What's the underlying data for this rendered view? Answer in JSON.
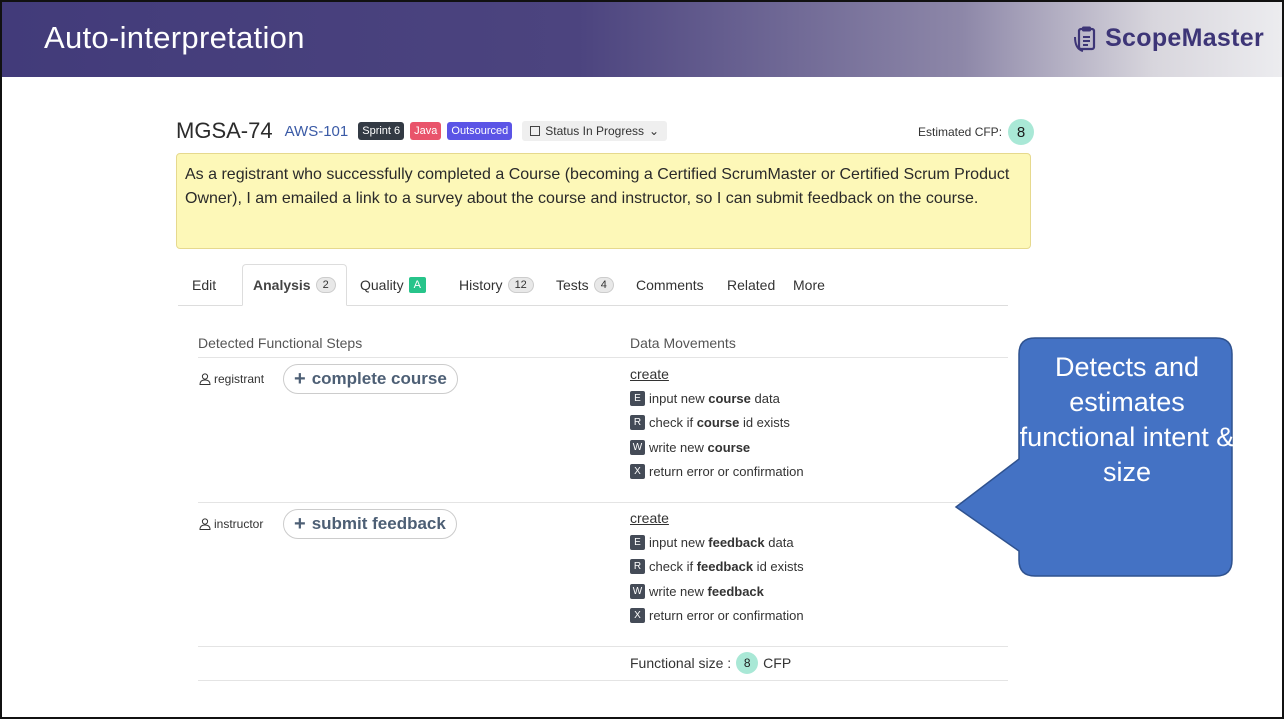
{
  "slide": {
    "title": "Auto-interpretation",
    "logo_text": "ScopeMaster"
  },
  "story": {
    "id": "MGSA-74",
    "aws": "AWS-101",
    "badges": [
      "Sprint 6",
      "Java",
      "Outsourced"
    ],
    "status": "Status In Progress",
    "estimated_label": "Estimated CFP:",
    "estimated_value": "8",
    "text": "As a registrant who successfully completed a Course (becoming a Certified ScrumMaster or Certified Scrum Product Owner), I am emailed a link to a survey about the course and instructor, so I can submit feedback on the course."
  },
  "tabs": {
    "edit": "Edit",
    "analysis": "Analysis",
    "analysis_count": "2",
    "quality": "Quality",
    "quality_grade": "A",
    "history": "History",
    "history_count": "12",
    "tests": "Tests",
    "tests_count": "4",
    "comments": "Comments",
    "related": "Related",
    "more": "More"
  },
  "analysis": {
    "steps_header": "Detected Functional Steps",
    "movements_header": "Data Movements",
    "rows": [
      {
        "actor": "registrant",
        "step": "complete course",
        "action": "create",
        "movements": [
          {
            "letter": "E",
            "pre": "input new ",
            "bold": "course",
            "post": " data"
          },
          {
            "letter": "R",
            "pre": "check if ",
            "bold": "course",
            "post": " id exists"
          },
          {
            "letter": "W",
            "pre": "write new ",
            "bold": "course",
            "post": ""
          },
          {
            "letter": "X",
            "pre": "return error or confirmation",
            "bold": "",
            "post": ""
          }
        ]
      },
      {
        "actor": "instructor",
        "step": "submit feedback",
        "action": "create",
        "movements": [
          {
            "letter": "E",
            "pre": "input new ",
            "bold": "feedback",
            "post": " data"
          },
          {
            "letter": "R",
            "pre": "check if ",
            "bold": "feedback",
            "post": " id exists"
          },
          {
            "letter": "W",
            "pre": "write new ",
            "bold": "feedback",
            "post": ""
          },
          {
            "letter": "X",
            "pre": "return error or confirmation",
            "bold": "",
            "post": ""
          }
        ]
      }
    ],
    "functional_size_label": "Functional size :",
    "functional_size_value": "8",
    "functional_size_unit": "CFP"
  },
  "callout": {
    "text": "Detects and estimates functional intent & size",
    "color": "#4472c4"
  }
}
